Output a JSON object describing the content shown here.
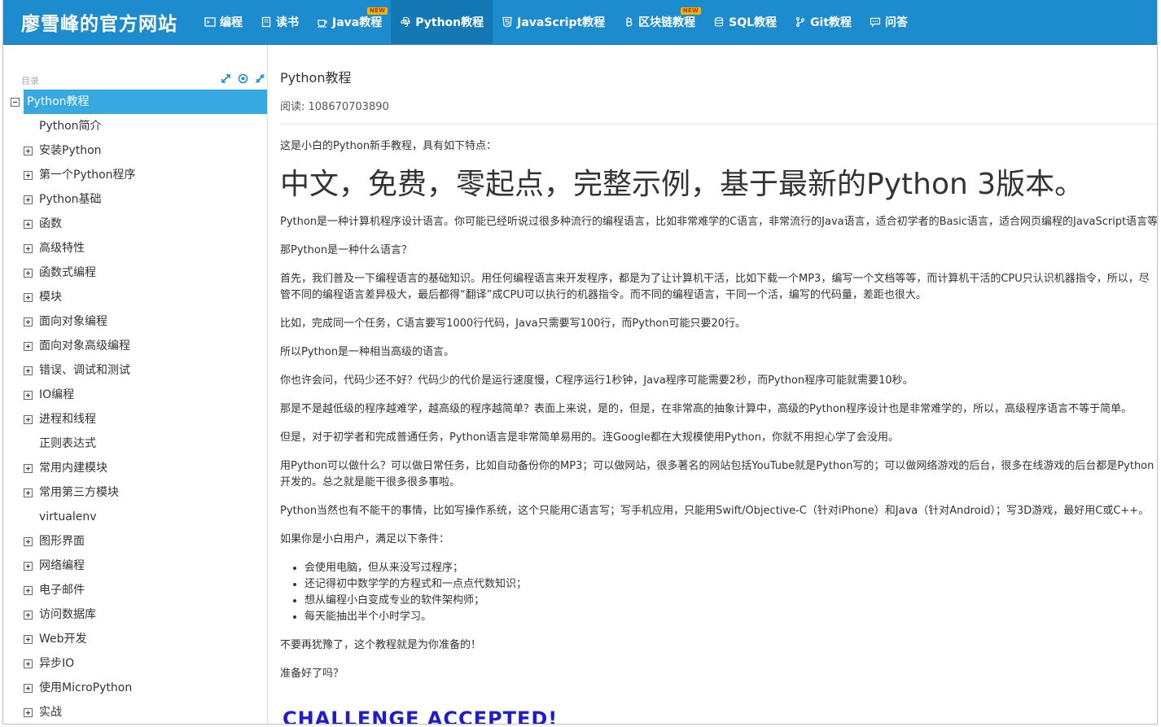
{
  "brand": "廖雪峰的官方网站",
  "nav": [
    {
      "label": "编程",
      "icon": "terminal-icon",
      "badge": ""
    },
    {
      "label": "读书",
      "icon": "book-icon",
      "badge": ""
    },
    {
      "label": "Java教程",
      "icon": "coffee-icon",
      "badge": "NEW"
    },
    {
      "label": "Python教程",
      "icon": "python-icon",
      "badge": "",
      "active": true
    },
    {
      "label": "JavaScript教程",
      "icon": "html5-icon",
      "badge": ""
    },
    {
      "label": "区块链教程",
      "icon": "bitcoin-icon",
      "badge": "NEW"
    },
    {
      "label": "SQL教程",
      "icon": "database-icon",
      "badge": ""
    },
    {
      "label": "Git教程",
      "icon": "git-branch-icon",
      "badge": ""
    },
    {
      "label": "问答",
      "icon": "comment-icon",
      "badge": ""
    }
  ],
  "sidebar": {
    "title": "目录",
    "root": "Python教程",
    "items": [
      {
        "label": "Python简介",
        "expandable": false
      },
      {
        "label": "安装Python",
        "expandable": true
      },
      {
        "label": "第一个Python程序",
        "expandable": true
      },
      {
        "label": "Python基础",
        "expandable": true
      },
      {
        "label": "函数",
        "expandable": true
      },
      {
        "label": "高级特性",
        "expandable": true
      },
      {
        "label": "函数式编程",
        "expandable": true
      },
      {
        "label": "模块",
        "expandable": true
      },
      {
        "label": "面向对象编程",
        "expandable": true
      },
      {
        "label": "面向对象高级编程",
        "expandable": true
      },
      {
        "label": "错误、调试和测试",
        "expandable": true
      },
      {
        "label": "IO编程",
        "expandable": true
      },
      {
        "label": "进程和线程",
        "expandable": true
      },
      {
        "label": "正则表达式",
        "expandable": false
      },
      {
        "label": "常用内建模块",
        "expandable": true
      },
      {
        "label": "常用第三方模块",
        "expandable": true
      },
      {
        "label": "virtualenv",
        "expandable": false
      },
      {
        "label": "图形界面",
        "expandable": true
      },
      {
        "label": "网络编程",
        "expandable": true
      },
      {
        "label": "电子邮件",
        "expandable": true
      },
      {
        "label": "访问数据库",
        "expandable": true
      },
      {
        "label": "Web开发",
        "expandable": true
      },
      {
        "label": "异步IO",
        "expandable": true
      },
      {
        "label": "使用MicroPython",
        "expandable": true
      },
      {
        "label": "实战",
        "expandable": true
      }
    ]
  },
  "content": {
    "title": "Python教程",
    "reads_label": "阅读: ",
    "reads_value": "108670703890",
    "intro": "这是小白的Python新手教程，具有如下特点：",
    "headline": "中文，免费，零起点，完整示例，基于最新的Python 3版本。",
    "paragraphs": [
      "Python是一种计算机程序设计语言。你可能已经听说过很多种流行的编程语言，比如非常难学的C语言，非常流行的Java语言，适合初学者的Basic语言，适合网页编程的JavaScript语言等等。",
      "那Python是一种什么语言？",
      "首先，我们普及一下编程语言的基础知识。用任何编程语言来开发程序，都是为了让计算机干活，比如下载一个MP3，编写一个文档等等，而计算机干活的CPU只认识机器指令，所以，尽管不同的编程语言差异极大，最后都得“翻译”成CPU可以执行的机器指令。而不同的编程语言，干同一个活，编写的代码量，差距也很大。",
      "比如，完成同一个任务，C语言要写1000行代码，Java只需要写100行，而Python可能只要20行。",
      "所以Python是一种相当高级的语言。",
      "你也许会问，代码少还不好？代码少的代价是运行速度慢，C程序运行1秒钟，Java程序可能需要2秒，而Python程序可能就需要10秒。",
      "那是不是越低级的程序越难学，越高级的程序越简单？表面上来说，是的，但是，在非常高的抽象计算中，高级的Python程序设计也是非常难学的，所以，高级程序语言不等于简单。",
      "但是，对于初学者和完成普通任务，Python语言是非常简单易用的。连Google都在大规模使用Python，你就不用担心学了会没用。",
      "用Python可以做什么？可以做日常任务，比如自动备份你的MP3；可以做网站，很多著名的网站包括YouTube就是Python写的；可以做网络游戏的后台，很多在线游戏的后台都是Python开发的。总之就是能干很多很多事啦。",
      "Python当然也有不能干的事情，比如写操作系统，这个只能用C语言写；写手机应用，只能用Swift/Objective-C（针对iPhone）和Java（针对Android）；写3D游戏，最好用C或C++。",
      "如果你是小白用户，满足以下条件："
    ],
    "list": [
      "会使用电脑，但从来没写过程序；",
      "还记得初中数学学的方程式和一点点代数知识；",
      "想从编程小白变成专业的软件架构师；",
      "每天能抽出半个小时学习。"
    ],
    "after_list": [
      "不要再犹豫了，这个教程就是为你准备的！",
      "准备好了吗？"
    ],
    "challenge": "CHALLENGE ACCEPTED!"
  }
}
